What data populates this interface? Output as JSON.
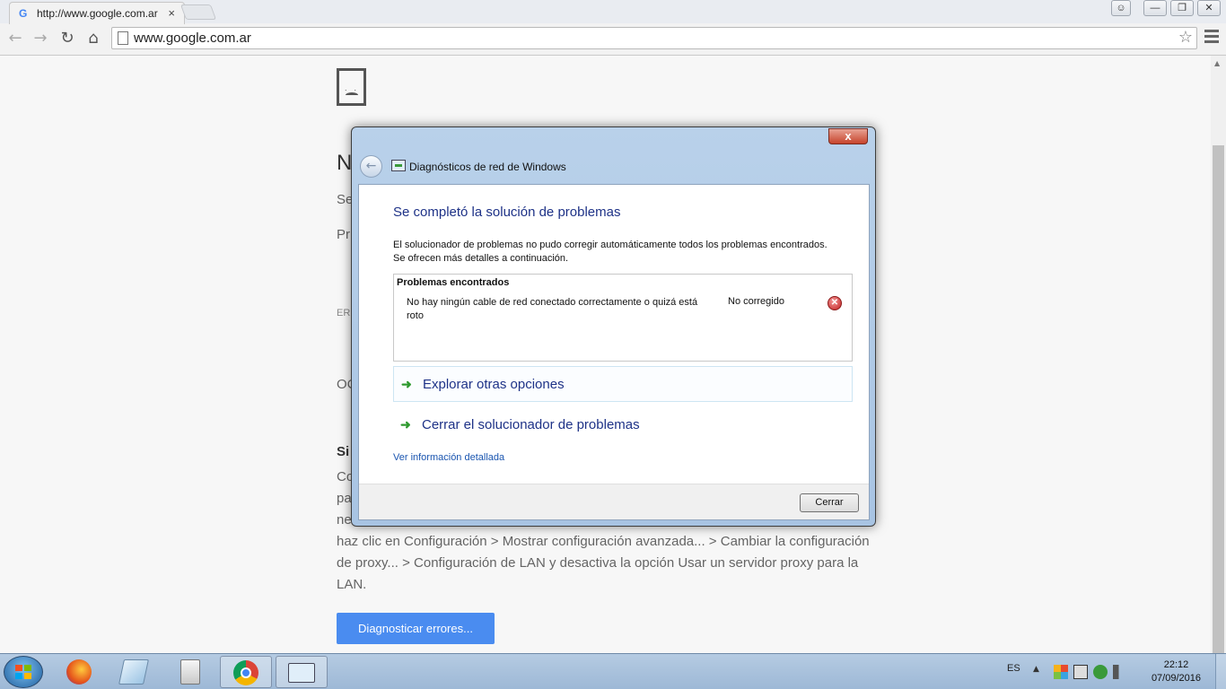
{
  "browser": {
    "tab_title": "http://www.google.com.ar",
    "tab_close": "×",
    "url": "www.google.com.ar",
    "back_icon": "arrow-left-icon",
    "forward_icon": "arrow-right-icon",
    "reload_icon": "reload-icon",
    "home_icon": "home-icon",
    "star_icon": "star-icon"
  },
  "page": {
    "heading_fragment": "N",
    "line1_fragment": "Se",
    "line2_fragment": "Pr",
    "error_code_fragment": "ER",
    "line3_fragment": "OC",
    "section_title_fragment": "Si",
    "para_line1": "Co",
    "para_line2": "pa",
    "para_line3": "ne",
    "para_line4": "haz clic en Configuración > Mostrar configuración avanzada... > Cambiar la configuración",
    "para_line5": "de proxy... > Configuración de LAN y desactiva la opción Usar un servidor proxy para la",
    "para_line6": "LAN.",
    "diagnose_button": "Diagnosticar errores..."
  },
  "dialog": {
    "title": "Diagnósticos de red de Windows",
    "close_glyph": "x",
    "heading": "Se completó la solución de problemas",
    "description": "El solucionador de problemas no pudo corregir automáticamente todos los problemas encontrados. Se ofrecen más detalles a continuación.",
    "problems_header": "Problemas encontrados",
    "problems": [
      {
        "text": "No hay ningún cable de red conectado correctamente o quizá está roto",
        "status": "No corregido"
      }
    ],
    "option_explore": "Explorar otras opciones",
    "option_close": "Cerrar el solucionador de problemas",
    "details_link": "Ver información detallada",
    "close_button": "Cerrar"
  },
  "taskbar": {
    "language": "ES",
    "time": "22:12",
    "date": "07/09/2016"
  },
  "colors": {
    "dialog_heading": "#1e3287",
    "link": "#1a55b0",
    "diagnose_button_bg": "#4a8cf0",
    "error_icon": "#c31f1f",
    "arrow_green": "#2f9a2f"
  }
}
